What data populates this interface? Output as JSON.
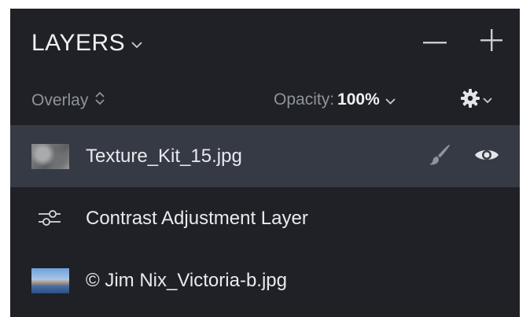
{
  "panel": {
    "title": "LAYERS",
    "blend_mode": "Overlay",
    "opacity_label": "Opacity:",
    "opacity_value": "100%"
  },
  "layers": [
    {
      "name": "Texture_Kit_15.jpg",
      "type": "image",
      "selected": true
    },
    {
      "name": "Contrast Adjustment Layer",
      "type": "adjustment",
      "selected": false
    },
    {
      "name": "© Jim Nix_Victoria-b.jpg",
      "type": "image",
      "selected": false
    }
  ],
  "icons": {
    "title_caret": "chevron-down-icon",
    "remove": "minus-icon",
    "add": "plus-icon",
    "blend_stepper": "up-down-chevron-icon",
    "opacity_caret": "chevron-down-icon",
    "settings": "gear-icon",
    "mask_brush": "brush-icon",
    "visibility": "eye-icon",
    "adjustment": "sliders-icon"
  },
  "colors": {
    "panel_bg": "#1f2127",
    "selected_row_bg": "#363a44",
    "text_primary": "#e8eaee",
    "text_secondary": "#8e939c"
  }
}
